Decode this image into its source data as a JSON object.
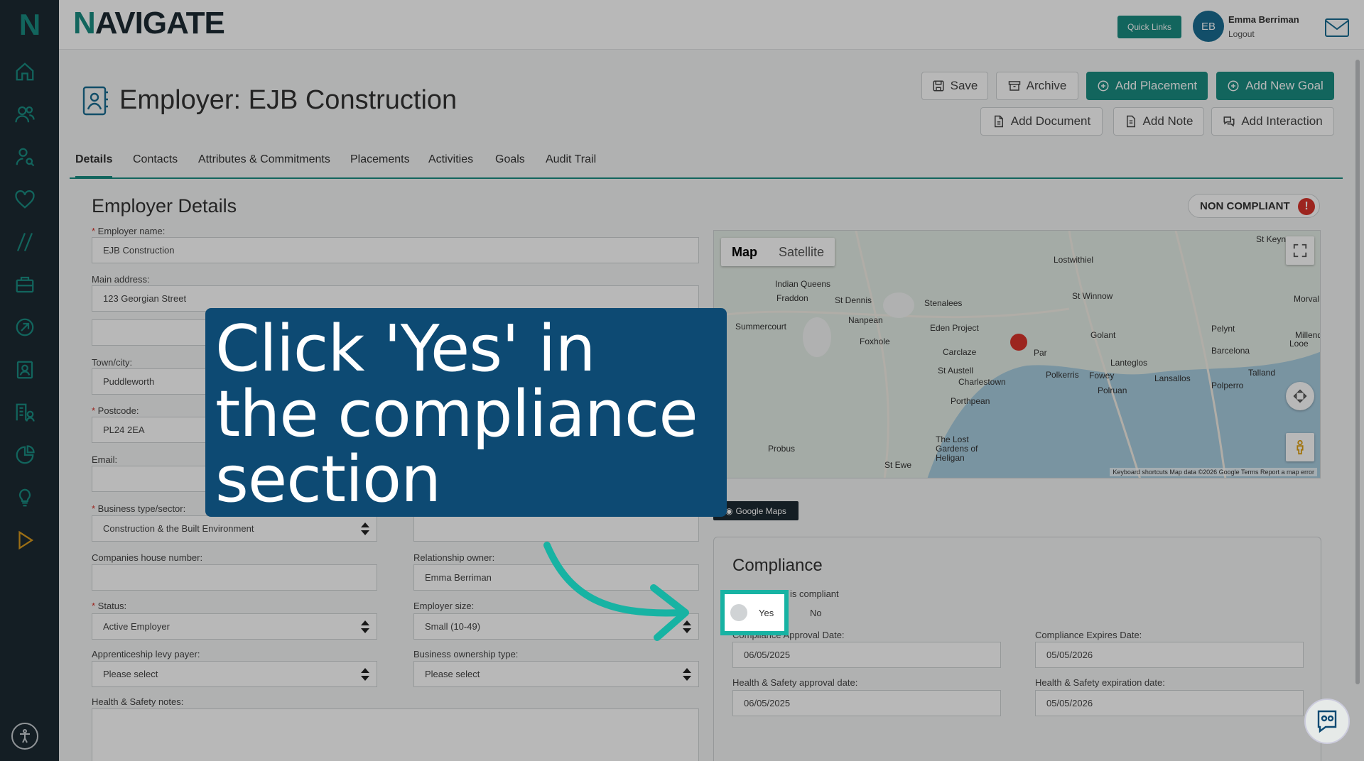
{
  "header": {
    "brand_first": "N",
    "brand_rest": "AVIGATE",
    "quick_links": "Quick Links",
    "avatar_initials": "EB",
    "user_name": "Emma Berriman",
    "logout": "Logout"
  },
  "page": {
    "title": "Employer: EJB Construction",
    "buttons": {
      "save": "Save",
      "archive": "Archive",
      "add_placement": "Add Placement",
      "add_new_goal": "Add New Goal",
      "add_document": "Add Document",
      "add_note": "Add Note",
      "add_interaction": "Add Interaction"
    }
  },
  "tabs": [
    "Details",
    "Contacts",
    "Attributes & Commitments",
    "Placements",
    "Activities",
    "Goals",
    "Audit Trail"
  ],
  "details": {
    "section_title": "Employer Details",
    "compliance_badge": "NON COMPLIANT",
    "employer_name_label": "Employer name:",
    "employer_name": "EJB Construction",
    "main_address_label": "Main address:",
    "main_address": "123 Georgian Street",
    "town_label": "Town/city:",
    "town": "Puddleworth",
    "postcode_label": "Postcode:",
    "postcode": "PL24 2EA",
    "email_label": "Email:",
    "business_type_label": "Business type/sector:",
    "business_type": "Construction & the Built Environment",
    "companies_house_label": "Companies house number:",
    "relationship_owner_label": "Relationship owner:",
    "relationship_owner": "Emma Berriman",
    "status_label": "Status:",
    "status": "Active Employer",
    "employer_size_label": "Employer size:",
    "employer_size": "Small (10-49)",
    "levy_label": "Apprenticeship levy payer:",
    "levy": "Please select",
    "ownership_label": "Business ownership type:",
    "ownership": "Please select",
    "hs_notes_label": "Health & Safety notes:"
  },
  "map": {
    "tab_map": "Map",
    "tab_satellite": "Satellite",
    "places": [
      "St Keyne",
      "Lostwithiel",
      "Indian Queens",
      "Fraddon",
      "St Dennis",
      "Stenalees",
      "St Winnow",
      "Morval",
      "Summercourt",
      "Nanpean",
      "Eden Project",
      "Par",
      "Golant",
      "Pelynt",
      "Millendreath",
      "Foxhole",
      "Carclaze",
      "Barcelona",
      "Lanteglos",
      "Looe",
      "St Austell",
      "Polkerris",
      "Fowey",
      "Lansallos",
      "Talland",
      "Charlestown",
      "Polruan",
      "Polperro",
      "Porthpean",
      "The Lost Gardens of Heligan",
      "Probus",
      "St Ewe"
    ],
    "footer": "Keyboard shortcuts   Map data ©2026 Google   Terms   Report a map error",
    "google_maps_button": "Google Maps"
  },
  "compliance": {
    "title": "Compliance",
    "is_compliant_label": "is compliant",
    "yes": "Yes",
    "no": "No",
    "approval_date_label": "Compliance Approval Date:",
    "approval_date": "06/05/2025",
    "expires_date_label": "Compliance Expires Date:",
    "expires_date": "05/05/2026",
    "hs_approval_label": "Health & Safety approval date:",
    "hs_approval": "06/05/2025",
    "hs_expiry_label": "Health & Safety expiration date:",
    "hs_expiry": "05/05/2026"
  },
  "callout": {
    "text": "Click 'Yes' in the compliance section"
  },
  "colors": {
    "teal": "#1a8c82",
    "highlight": "#17b3a3",
    "callout_bg": "#0d4a73",
    "sidebar_bg": "#1d2a33"
  }
}
